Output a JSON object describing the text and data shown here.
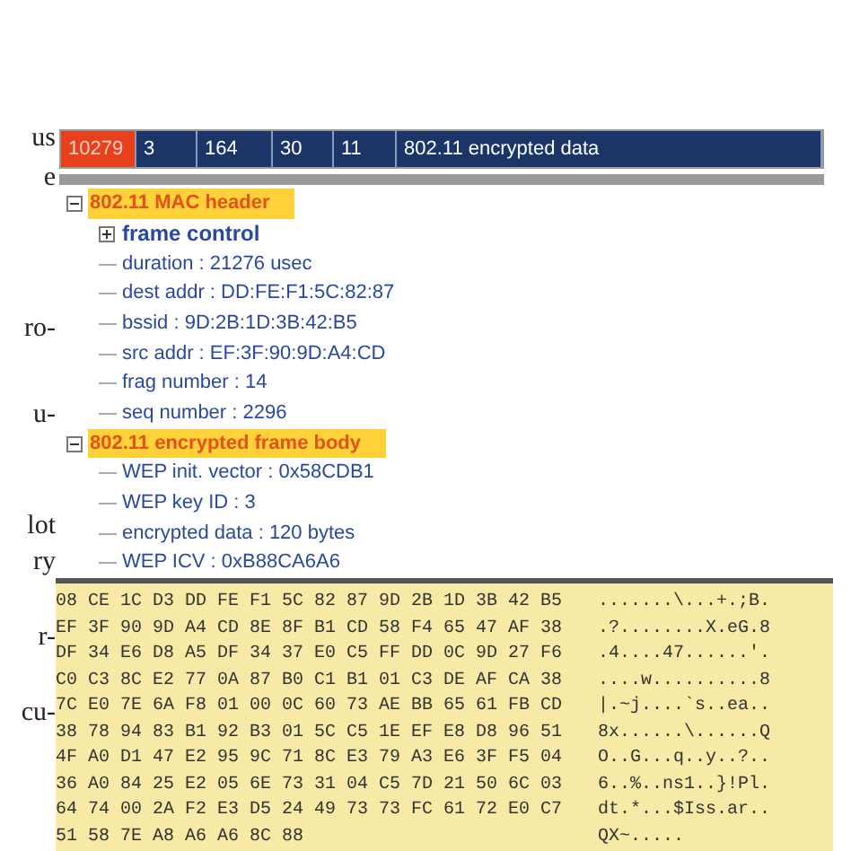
{
  "margin_text": [
    "us",
    "e",
    "ro-",
    "u-",
    "lot",
    "ry",
    "r-",
    "cu-"
  ],
  "packet_row": {
    "cells": [
      {
        "text": "10279",
        "selected": true
      },
      {
        "text": "3",
        "selected": false
      },
      {
        "text": "164",
        "selected": false
      },
      {
        "text": "30",
        "selected": false
      },
      {
        "text": "11",
        "selected": false
      },
      {
        "text": "802.11 encrypted data",
        "selected": false
      }
    ]
  },
  "tree": [
    {
      "label": "802.11 MAC header",
      "expanded": true,
      "highlighted": true,
      "children": [
        {
          "label": "frame control",
          "expanded": false,
          "bold": true
        },
        {
          "label": "duration : 21276 usec"
        },
        {
          "label": "dest addr : DD:FE:F1:5C:82:87"
        },
        {
          "label": "bssid : 9D:2B:1D:3B:42:B5"
        },
        {
          "label": "src addr : EF:3F:90:9D:A4:CD"
        },
        {
          "label": "frag number : 14"
        },
        {
          "label": "seq number : 2296"
        }
      ]
    },
    {
      "label": "802.11 encrypted frame body",
      "expanded": true,
      "highlighted": true,
      "children": [
        {
          "label": "WEP init. vector : 0x58CDB1"
        },
        {
          "label": "WEP key ID : 3"
        },
        {
          "label": "encrypted data : 120 bytes"
        },
        {
          "label": "WEP ICV : 0xB88CA6A6"
        }
      ]
    }
  ],
  "hex_dump": [
    {
      "hex": "08 CE 1C D3 DD FE F1 5C 82 87 9D 2B 1D 3B 42 B5",
      "ascii": ".......\\...+.;B."
    },
    {
      "hex": "EF 3F 90 9D A4 CD 8E 8F B1 CD 58 F4 65 47 AF 38",
      "ascii": ".?........X.eG.8"
    },
    {
      "hex": "DF 34 E6 D8 A5 DF 34 37 E0 C5 FF DD 0C 9D 27 F6",
      "ascii": ".4....47......'."
    },
    {
      "hex": "C0 C3 8C E2 77 0A 87 B0 C1 B1 01 C3 DE AF CA 38",
      "ascii": "....w..........8"
    },
    {
      "hex": "7C E0 7E 6A F8 01 00 0C 60 73 AE BB 65 61 FB CD",
      "ascii": "|.~j....`s..ea.."
    },
    {
      "hex": "38 78 94 83 B1 92 B3 01 5C C5 1E EF E8 D8 96 51",
      "ascii": "8x......\\......Q"
    },
    {
      "hex": "4F A0 D1 47 E2 95 9C 71 8C E3 79 A3 E6 3F F5 04",
      "ascii": "O..G...q..y..?.."
    },
    {
      "hex": "36 A0 84 25 E2 05 6E 73 31 04 C5 7D 21 50 6C 03",
      "ascii": "6..%..ns1..}!Pl."
    },
    {
      "hex": "64 74 00 2A F2 E3 D5 24 49 73 73 FC 61 72 E0 C7",
      "ascii": "dt.*...$Iss.ar.."
    },
    {
      "hex": "51 58 7E A8 A6 A6 8C 88",
      "ascii": "QX~....."
    }
  ]
}
